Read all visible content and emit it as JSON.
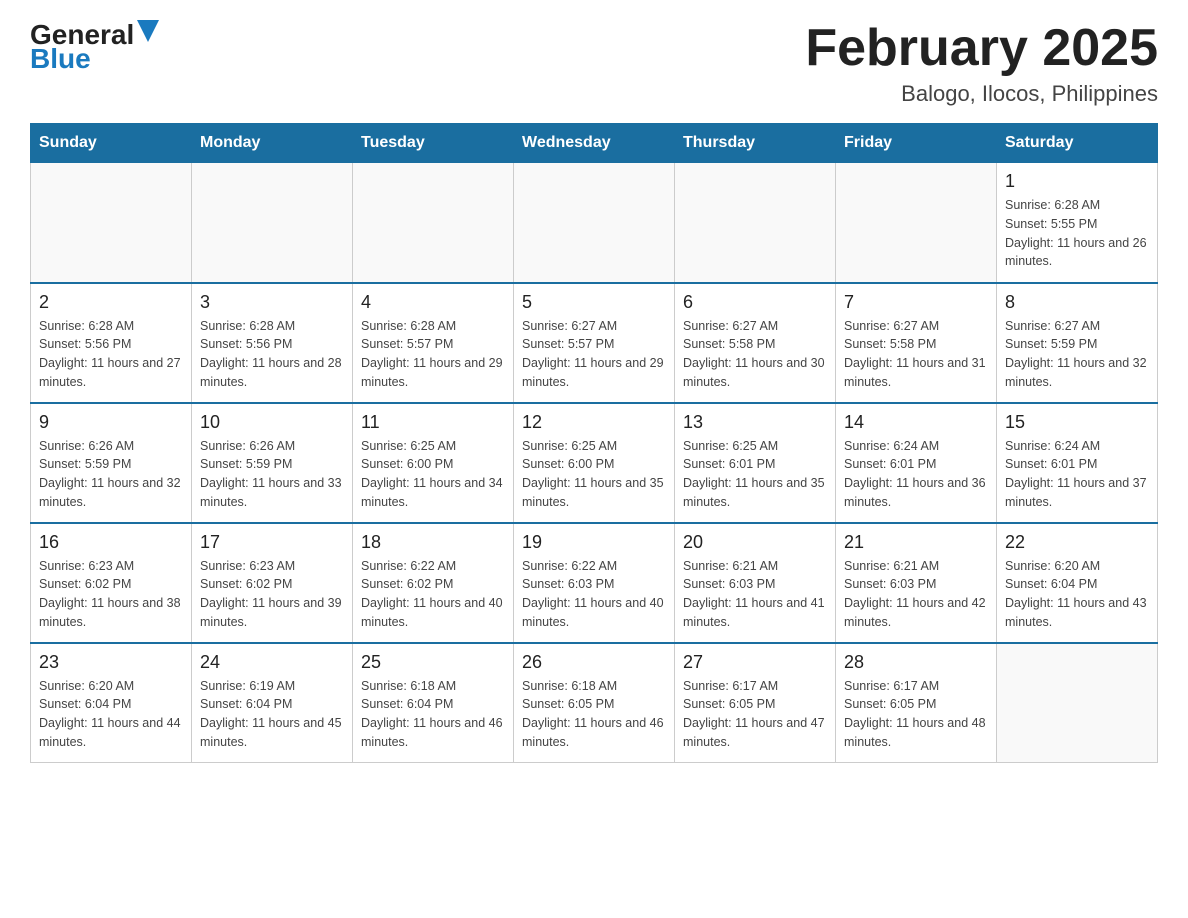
{
  "header": {
    "logo_general": "General",
    "logo_blue": "Blue",
    "month_title": "February 2025",
    "location": "Balogo, Ilocos, Philippines"
  },
  "days_of_week": [
    "Sunday",
    "Monday",
    "Tuesday",
    "Wednesday",
    "Thursday",
    "Friday",
    "Saturday"
  ],
  "weeks": [
    [
      {
        "day": "",
        "info": ""
      },
      {
        "day": "",
        "info": ""
      },
      {
        "day": "",
        "info": ""
      },
      {
        "day": "",
        "info": ""
      },
      {
        "day": "",
        "info": ""
      },
      {
        "day": "",
        "info": ""
      },
      {
        "day": "1",
        "info": "Sunrise: 6:28 AM\nSunset: 5:55 PM\nDaylight: 11 hours and 26 minutes."
      }
    ],
    [
      {
        "day": "2",
        "info": "Sunrise: 6:28 AM\nSunset: 5:56 PM\nDaylight: 11 hours and 27 minutes."
      },
      {
        "day": "3",
        "info": "Sunrise: 6:28 AM\nSunset: 5:56 PM\nDaylight: 11 hours and 28 minutes."
      },
      {
        "day": "4",
        "info": "Sunrise: 6:28 AM\nSunset: 5:57 PM\nDaylight: 11 hours and 29 minutes."
      },
      {
        "day": "5",
        "info": "Sunrise: 6:27 AM\nSunset: 5:57 PM\nDaylight: 11 hours and 29 minutes."
      },
      {
        "day": "6",
        "info": "Sunrise: 6:27 AM\nSunset: 5:58 PM\nDaylight: 11 hours and 30 minutes."
      },
      {
        "day": "7",
        "info": "Sunrise: 6:27 AM\nSunset: 5:58 PM\nDaylight: 11 hours and 31 minutes."
      },
      {
        "day": "8",
        "info": "Sunrise: 6:27 AM\nSunset: 5:59 PM\nDaylight: 11 hours and 32 minutes."
      }
    ],
    [
      {
        "day": "9",
        "info": "Sunrise: 6:26 AM\nSunset: 5:59 PM\nDaylight: 11 hours and 32 minutes."
      },
      {
        "day": "10",
        "info": "Sunrise: 6:26 AM\nSunset: 5:59 PM\nDaylight: 11 hours and 33 minutes."
      },
      {
        "day": "11",
        "info": "Sunrise: 6:25 AM\nSunset: 6:00 PM\nDaylight: 11 hours and 34 minutes."
      },
      {
        "day": "12",
        "info": "Sunrise: 6:25 AM\nSunset: 6:00 PM\nDaylight: 11 hours and 35 minutes."
      },
      {
        "day": "13",
        "info": "Sunrise: 6:25 AM\nSunset: 6:01 PM\nDaylight: 11 hours and 35 minutes."
      },
      {
        "day": "14",
        "info": "Sunrise: 6:24 AM\nSunset: 6:01 PM\nDaylight: 11 hours and 36 minutes."
      },
      {
        "day": "15",
        "info": "Sunrise: 6:24 AM\nSunset: 6:01 PM\nDaylight: 11 hours and 37 minutes."
      }
    ],
    [
      {
        "day": "16",
        "info": "Sunrise: 6:23 AM\nSunset: 6:02 PM\nDaylight: 11 hours and 38 minutes."
      },
      {
        "day": "17",
        "info": "Sunrise: 6:23 AM\nSunset: 6:02 PM\nDaylight: 11 hours and 39 minutes."
      },
      {
        "day": "18",
        "info": "Sunrise: 6:22 AM\nSunset: 6:02 PM\nDaylight: 11 hours and 40 minutes."
      },
      {
        "day": "19",
        "info": "Sunrise: 6:22 AM\nSunset: 6:03 PM\nDaylight: 11 hours and 40 minutes."
      },
      {
        "day": "20",
        "info": "Sunrise: 6:21 AM\nSunset: 6:03 PM\nDaylight: 11 hours and 41 minutes."
      },
      {
        "day": "21",
        "info": "Sunrise: 6:21 AM\nSunset: 6:03 PM\nDaylight: 11 hours and 42 minutes."
      },
      {
        "day": "22",
        "info": "Sunrise: 6:20 AM\nSunset: 6:04 PM\nDaylight: 11 hours and 43 minutes."
      }
    ],
    [
      {
        "day": "23",
        "info": "Sunrise: 6:20 AM\nSunset: 6:04 PM\nDaylight: 11 hours and 44 minutes."
      },
      {
        "day": "24",
        "info": "Sunrise: 6:19 AM\nSunset: 6:04 PM\nDaylight: 11 hours and 45 minutes."
      },
      {
        "day": "25",
        "info": "Sunrise: 6:18 AM\nSunset: 6:04 PM\nDaylight: 11 hours and 46 minutes."
      },
      {
        "day": "26",
        "info": "Sunrise: 6:18 AM\nSunset: 6:05 PM\nDaylight: 11 hours and 46 minutes."
      },
      {
        "day": "27",
        "info": "Sunrise: 6:17 AM\nSunset: 6:05 PM\nDaylight: 11 hours and 47 minutes."
      },
      {
        "day": "28",
        "info": "Sunrise: 6:17 AM\nSunset: 6:05 PM\nDaylight: 11 hours and 48 minutes."
      },
      {
        "day": "",
        "info": ""
      }
    ]
  ]
}
